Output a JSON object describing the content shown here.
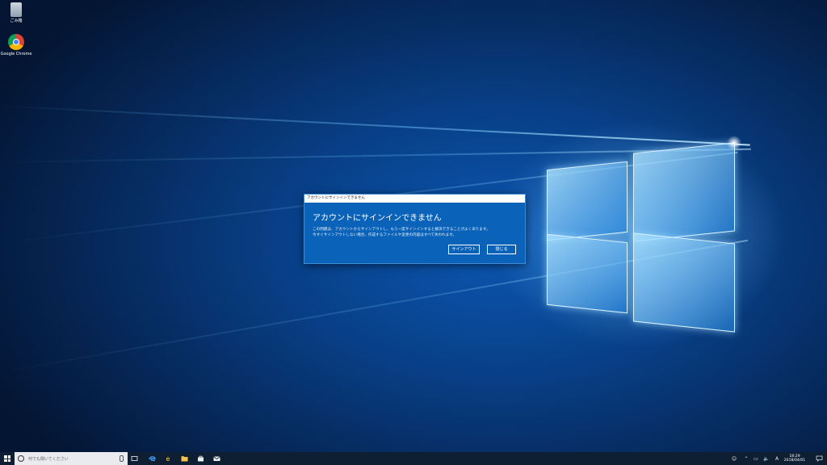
{
  "desktop": {
    "icons": [
      {
        "label": "ごみ箱",
        "icon": "recycle-bin-icon"
      },
      {
        "label": "Google Chrome",
        "icon": "chrome-icon"
      }
    ]
  },
  "dialog": {
    "title": "アカウントにサインインできません",
    "heading": "アカウントにサインインできません",
    "body_line1": "この問題は、アカウントからサインアウトし、もう一度サインインすると解決できることがよくあります。",
    "body_line2": "今すぐサインアウトしない場合、作成するファイルや変更の内容はすべて失われます。",
    "signout_label": "サインアウト",
    "close_label": "閉じる"
  },
  "taskbar": {
    "search_placeholder": "何でも聞いてください",
    "pinned": [
      "task-view-icon",
      "edge-icon",
      "internet-explorer-icon",
      "file-explorer-icon",
      "store-icon",
      "mail-icon"
    ],
    "tray": [
      "people-icon",
      "chevron-up-icon",
      "network-icon",
      "volume-icon",
      "ime-icon"
    ],
    "ime_label": "A",
    "clock_time": "18:29",
    "clock_date": "2018/04/01"
  },
  "colors": {
    "dialog_bg": "#0a63b8",
    "taskbar_bg": "#0f1f33",
    "wallpaper_accent": "#0b57b3"
  }
}
